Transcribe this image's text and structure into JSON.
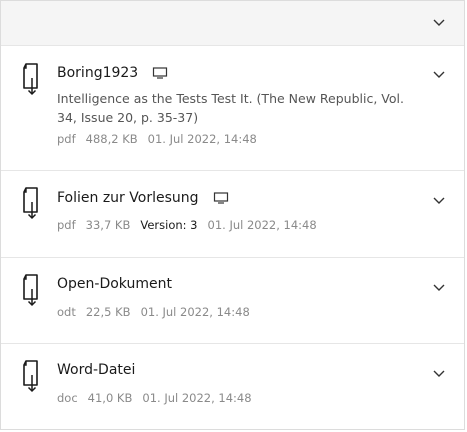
{
  "files": [
    {
      "title": "Boring1923",
      "description": "Intelligence as the Tests Test It. (The New Republic, Vol. 34, Issue 20, p. 35-37)",
      "type": "pdf",
      "size": "488,2 KB",
      "version": "",
      "date": "01. Jul 2022, 14:48",
      "has_preview": true
    },
    {
      "title": "Folien zur Vorlesung",
      "description": "",
      "type": "pdf",
      "size": "33,7 KB",
      "version": "Version: 3",
      "date": "01. Jul 2022, 14:48",
      "has_preview": true
    },
    {
      "title": "Open-Dokument",
      "description": "",
      "type": "odt",
      "size": "22,5 KB",
      "version": "",
      "date": "01. Jul 2022, 14:48",
      "has_preview": false
    },
    {
      "title": "Word-Datei",
      "description": "",
      "type": "doc",
      "size": "41,0 KB",
      "version": "",
      "date": "01. Jul 2022, 14:48",
      "has_preview": false
    }
  ],
  "icons": {
    "file": "file-download-icon",
    "preview": "monitor-icon",
    "expand": "chevron-down-icon"
  },
  "colors": {
    "header_bg": "#f5f5f5",
    "border": "#dcdcdc",
    "text": "#1a1a1a",
    "muted": "#8a8a8a"
  }
}
